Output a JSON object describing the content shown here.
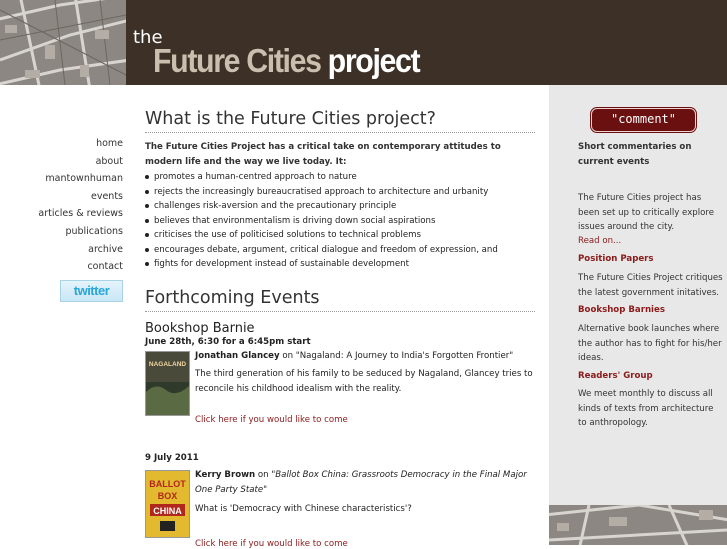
{
  "header": {
    "brand_the": "the",
    "brand_future_cities": "Future Cities",
    "brand_project": "project"
  },
  "nav": {
    "items": [
      "home",
      "about",
      "mantownhuman",
      "events",
      "articles & reviews",
      "publications",
      "archive",
      "contact"
    ],
    "twitter_label": "twitter"
  },
  "main": {
    "heading": "What is the Future Cities project?",
    "intro": "The Future Cities Project has a critical take on contemporary attitudes to modern life and the way we live today. It:",
    "bullets": [
      "promotes a human-centred approach to nature",
      "rejects the increasingly bureaucratised approach to architecture and urbanity",
      "challenges risk-aversion and the precautionary principle",
      "believes that environmentalism is driving down social aspirations",
      "criticises the use of politicised solutions to technical problems",
      "encourages debate, argument, critical dialogue and freedom of expression, and",
      "fights for development instead of sustainable development"
    ],
    "events_heading": "Forthcoming Events",
    "event1": {
      "title": "Bookshop Barnie",
      "date": "June 28th, 6:30 for a 6:45pm start",
      "speaker": "Jonathan Glancey",
      "on": " on \"Nagaland: A Journey to India's Forgotten Frontier\"",
      "desc": "The third generation of his family to be seduced by Nagaland, Glancey tries to reconcile his childhood idealism with the reality.",
      "link": "Click here if you would like to come",
      "book_word": "NAGALAND"
    },
    "event2": {
      "date": "9 July 2011",
      "speaker": "Kerry Brown",
      "on_prefix": " on \"",
      "book_title": "Ballot Box China: Grassroots Democracy in the Final Major One Party State",
      "on_suffix": "\"",
      "desc": "What is 'Democracy with Chinese characteristics'?",
      "link": "Click here if you would like to come",
      "book_words": [
        "BALLOT",
        "BOX",
        "CHINA"
      ]
    }
  },
  "right": {
    "comment_label": "\"comment\"",
    "comment_desc": "Short commentaries on current events",
    "about_text": "The Future Cities project has been set up to critically explore issues around the city.",
    "read_on": "Read on...",
    "position_papers_head": "Position Papers",
    "position_papers_text": "The Future Cities Project critiques the latest government initatives.",
    "bookshop_head": "Bookshop Barnies",
    "bookshop_text": "Alternative book launches where the author has to fight for his/her ideas.",
    "readers_head": "Readers' Group",
    "readers_text": "We meet monthly to discuss all kinds of texts from architecture to anthropology."
  },
  "colors": {
    "header_bg": "#3d3027",
    "accent_red": "#8b1a1a",
    "right_panel_bg": "#e8e8e8"
  }
}
